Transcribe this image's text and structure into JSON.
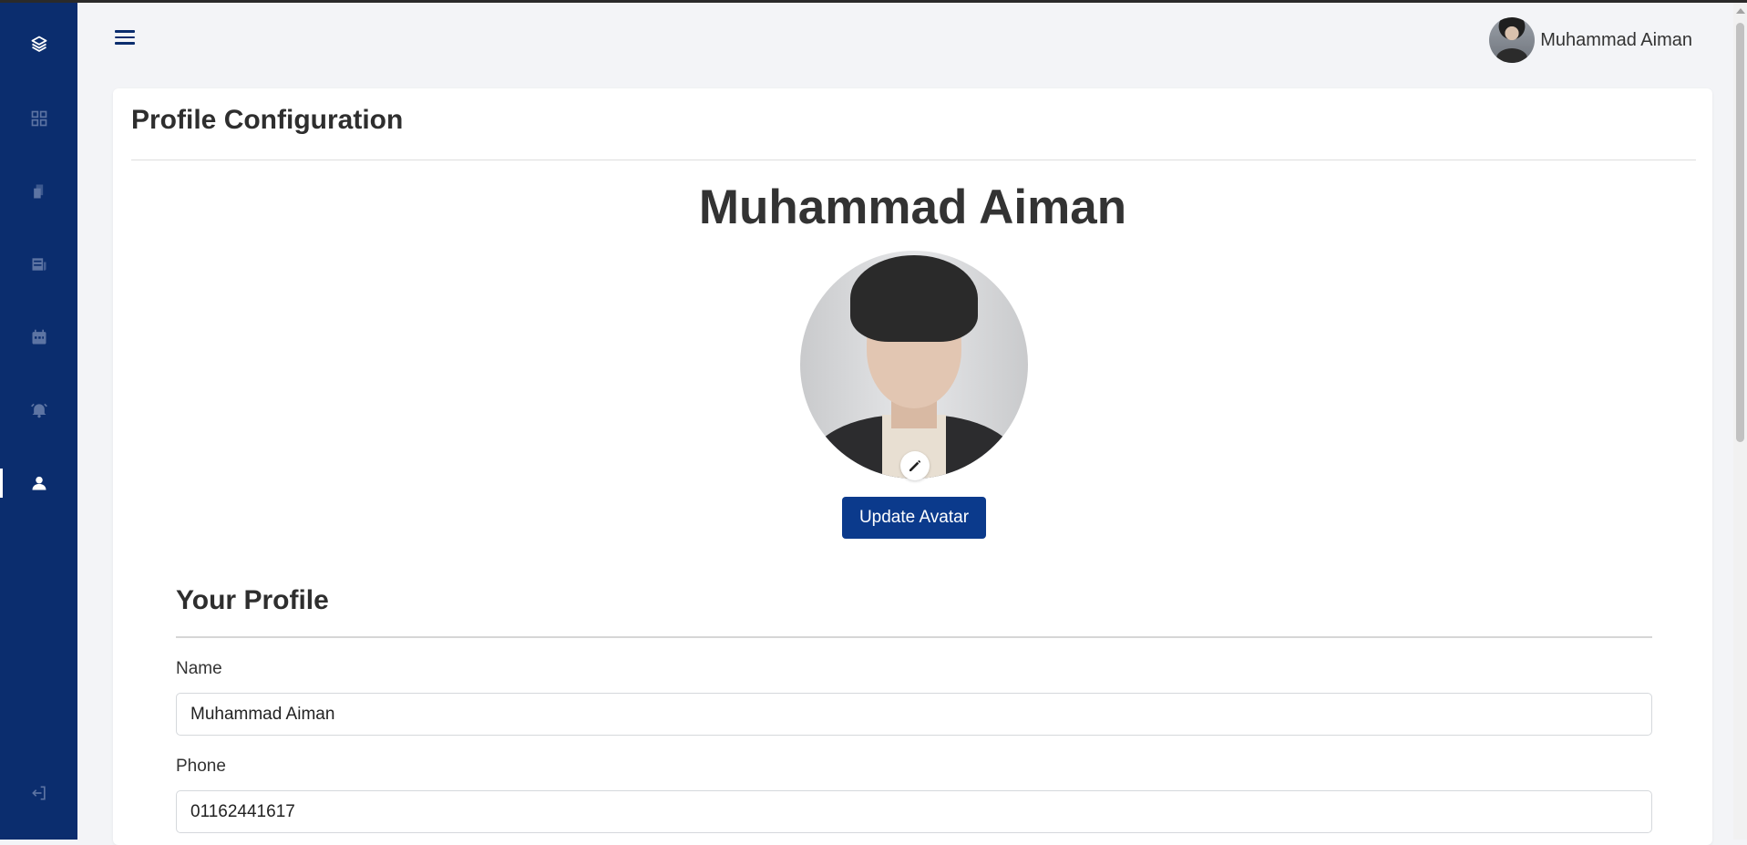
{
  "sidebar": {
    "items": [
      {
        "name": "brand",
        "icon": "layers-icon"
      },
      {
        "name": "dashboard",
        "icon": "grid-icon"
      },
      {
        "name": "documents",
        "icon": "document-icon"
      },
      {
        "name": "news",
        "icon": "newspaper-icon"
      },
      {
        "name": "calendar",
        "icon": "calendar-icon"
      },
      {
        "name": "alerts",
        "icon": "alarm-icon"
      },
      {
        "name": "profile",
        "icon": "user-icon",
        "active": true
      },
      {
        "name": "logout",
        "icon": "logout-icon"
      }
    ]
  },
  "header": {
    "menu_icon": "hamburger-icon",
    "user_name": "Muhammad Aiman"
  },
  "card": {
    "title": "Profile Configuration",
    "profile_name": "Muhammad Aiman",
    "edit_icon": "pencil-icon",
    "update_avatar_label": "Update Avatar"
  },
  "profile_form": {
    "section_title": "Your Profile",
    "name_label": "Name",
    "name_value": "Muhammad Aiman",
    "phone_label": "Phone",
    "phone_value": "01162441617"
  },
  "colors": {
    "sidebar": "#0b2d6e",
    "primary_button": "#0b3a8c"
  }
}
